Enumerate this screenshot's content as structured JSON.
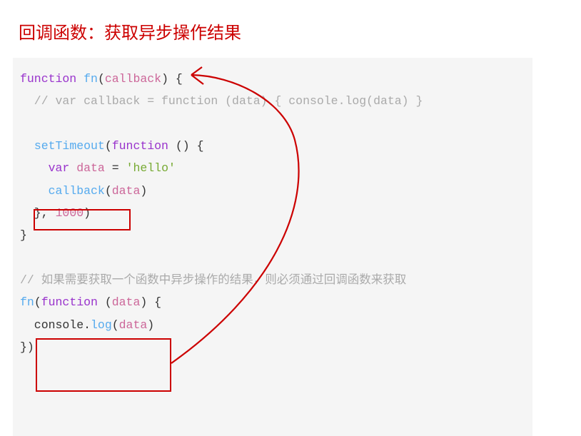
{
  "title": "回调函数：获取异步操作结果",
  "code": {
    "l1_kw1": "function",
    "l1_fn": "fn",
    "l1_open": "(",
    "l1_param": "callback",
    "l1_close": ") {",
    "l2_comment": "  // var callback = function (data) { console.log(data) }",
    "l3": "",
    "l4_pre": "  ",
    "l4_call": "setTimeout",
    "l4_open": "(",
    "l4_kw": "function",
    "l4_close": " () {",
    "l5_pre": "    ",
    "l5_var": "var",
    "l5_id": " data",
    "l5_eq": " = ",
    "l5_str": "'hello'",
    "l6_pre": "    ",
    "l6_call": "callback",
    "l6_open": "(",
    "l6_arg": "data",
    "l6_close": ")",
    "l7_pre": "  }, ",
    "l7_num": "1000",
    "l7_close": ")",
    "l8": "}",
    "l9": "",
    "l10_comment": "// 如果需要获取一个函数中异步操作的结果，则必须通过回调函数来获取",
    "l11_fn": "fn",
    "l11_open": "(",
    "l11_kw": "function",
    "l11_args": " (",
    "l11_param": "data",
    "l11_close": ") {",
    "l12_pre": "  console.",
    "l12_call": "log",
    "l12_open": "(",
    "l12_arg": "data",
    "l12_close": ")",
    "l13": "})"
  },
  "annotations": {
    "box1_label": "callback(data) highlight",
    "box2_label": "anonymous function argument highlight",
    "arrow_label": "arrow from usage to callback parameter",
    "arrow_color": "#cc0000"
  }
}
